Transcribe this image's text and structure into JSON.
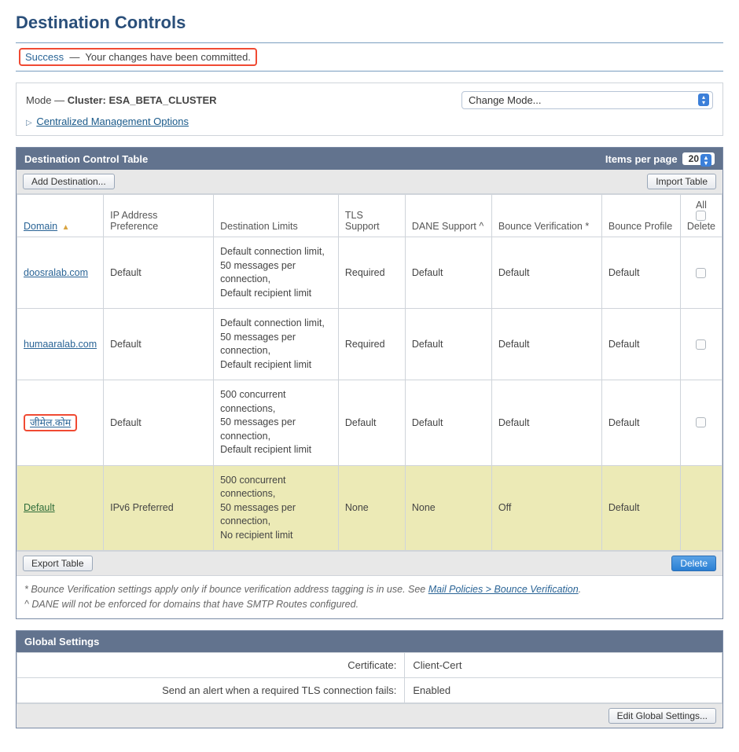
{
  "page_title": "Destination Controls",
  "success": {
    "word": "Success",
    "separator": "—",
    "message": "Your changes have been committed."
  },
  "mode_panel": {
    "prefix": "Mode —",
    "cluster_label": "Cluster:",
    "cluster_name": "ESA_BETA_CLUSTER",
    "change_mode_placeholder": "Change Mode...",
    "cmo_label": "Centralized Management Options"
  },
  "dct": {
    "header_title": "Destination Control Table",
    "items_per_page_label": "Items per page",
    "items_per_page_value": "20",
    "add_button": "Add Destination...",
    "import_button": "Import Table",
    "export_button": "Export Table",
    "delete_button": "Delete",
    "columns": {
      "domain": "Domain",
      "ip_pref": "IP Address Preference",
      "dest_limits": "Destination Limits",
      "tls": "TLS Support",
      "dane": "DANE Support ^",
      "bounce_ver": "Bounce Verification *",
      "bounce_prof": "Bounce Profile",
      "delete_all": "All",
      "delete": "Delete"
    },
    "rows": [
      {
        "domain": "doosralab.com",
        "ip_pref": "Default",
        "limits": "Default connection limit,\n50 messages per connection,\nDefault recipient limit",
        "tls": "Required",
        "dane": "Default",
        "bounce_ver": "Default",
        "bounce_prof": "Default",
        "highlight": false,
        "default_row": false
      },
      {
        "domain": "humaaralab.com",
        "ip_pref": "Default",
        "limits": "Default connection limit,\n50 messages per connection,\nDefault recipient limit",
        "tls": "Required",
        "dane": "Default",
        "bounce_ver": "Default",
        "bounce_prof": "Default",
        "highlight": false,
        "default_row": false
      },
      {
        "domain": "जीमेल.कोम",
        "ip_pref": "Default",
        "limits": "500 concurrent connections,\n50 messages per connection,\nDefault recipient limit",
        "tls": "Default",
        "dane": "Default",
        "bounce_ver": "Default",
        "bounce_prof": "Default",
        "highlight": true,
        "default_row": false
      },
      {
        "domain": "Default",
        "ip_pref": "IPv6 Preferred",
        "limits": "500 concurrent connections,\n50 messages per connection,\nNo recipient limit",
        "tls": "None",
        "dane": "None",
        "bounce_ver": "Off",
        "bounce_prof": "Default",
        "highlight": false,
        "default_row": true
      }
    ],
    "footnote_bounce_pre": "* Bounce Verification settings apply only if bounce verification address tagging is in use. See ",
    "footnote_bounce_link": "Mail Policies > Bounce Verification",
    "footnote_bounce_post": ".",
    "footnote_dane": "^ DANE will not be enforced for domains that have SMTP Routes configured."
  },
  "global_settings": {
    "title": "Global Settings",
    "rows": [
      {
        "label": "Certificate:",
        "value": "Client-Cert"
      },
      {
        "label": "Send an alert when a required TLS connection fails:",
        "value": "Enabled"
      }
    ],
    "edit_button": "Edit Global Settings..."
  }
}
